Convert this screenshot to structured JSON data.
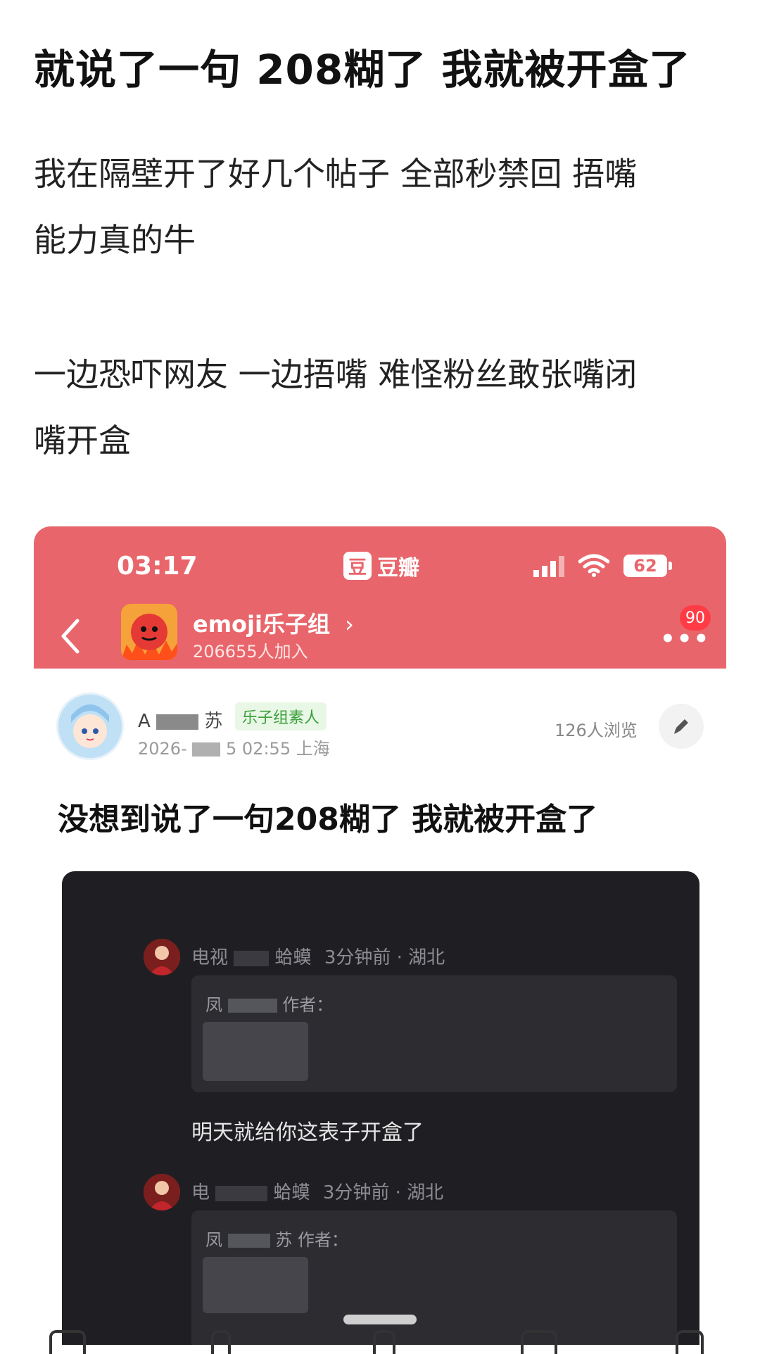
{
  "post": {
    "title": "就说了一句 208糊了 我就被开盒了",
    "body_line1": "我在隔壁开了好几个帖子 全部秒禁回 捂嘴",
    "body_line2": "能力真的牛",
    "body_line3": "一边恐吓网友 一边捂嘴 难怪粉丝敢张嘴闭",
    "body_line4": "嘴开盒"
  },
  "screenshot": {
    "status": {
      "time": "03:17",
      "app_name": "豆瓣",
      "app_icon_char": "豆",
      "battery": "62"
    },
    "group": {
      "name": "emoji乐子组",
      "chevron": "›",
      "members": "206655人加入",
      "more": "•••",
      "badge": "90"
    },
    "author": {
      "name_prefix": "A",
      "name_suffix": "苏",
      "tag": "乐子组素人",
      "time_prefix": "2026-",
      "time_suffix": "5 02:55 上海",
      "views": "126人浏览"
    },
    "post_title": "没想到说了一句208糊了 我就被开盒了",
    "comments": [
      {
        "name_prefix": "电视",
        "name_suffix": "蛤蟆",
        "meta": "3分钟前 · 湖北",
        "quote_name": "凤",
        "quote_label": "作者：",
        "text": "明天就给你这表子开盒了"
      },
      {
        "name_prefix": "电",
        "name_suffix": "蛤蟆",
        "meta": "3分钟前 · 湖北",
        "quote_name": "凤",
        "quote_name_suffix": "苏",
        "quote_label": "作者：",
        "text": ""
      }
    ]
  },
  "colors": {
    "header_red": "#e8666b",
    "badge_red": "#ff3b45",
    "tag_green": "#3a9f3a",
    "dark_panel": "#1f1f23"
  },
  "icons": {
    "back": "back-chevron-icon",
    "signal": "signal-icon",
    "wifi": "wifi-icon",
    "edit": "pencil-icon"
  }
}
